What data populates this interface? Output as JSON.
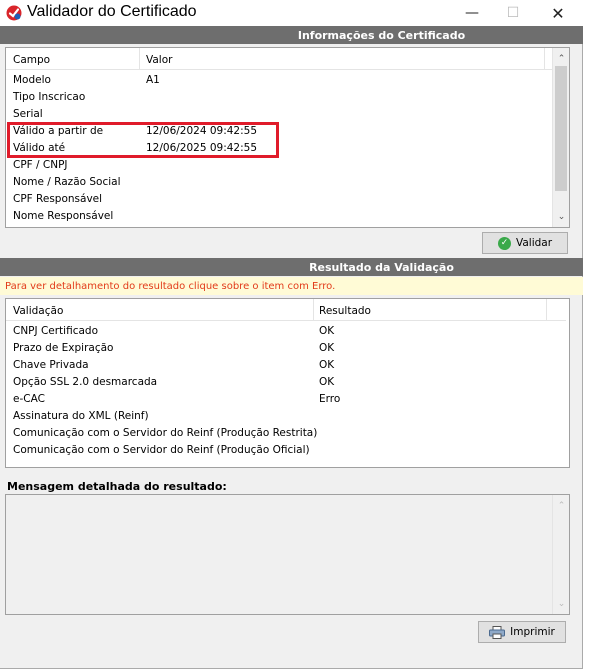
{
  "window": {
    "title": "Validador do Certificado",
    "controls": {
      "minimize": "—",
      "maximize": "☐",
      "close": "✕"
    }
  },
  "cert_section": {
    "header": "Informações do Certificado",
    "columns": [
      "Campo",
      "Valor"
    ],
    "rows": [
      {
        "campo": "Modelo",
        "valor": "A1"
      },
      {
        "campo": "Tipo Inscricao",
        "valor": ""
      },
      {
        "campo": "Serial",
        "valor": ""
      },
      {
        "campo": "Válido a partir de",
        "valor": "12/06/2024 09:42:55"
      },
      {
        "campo": "Válido até",
        "valor": "12/06/2025 09:42:55"
      },
      {
        "campo": "CPF / CNPJ",
        "valor": ""
      },
      {
        "campo": "Nome / Razão Social",
        "valor": ""
      },
      {
        "campo": "CPF Responsável",
        "valor": ""
      },
      {
        "campo": "Nome Responsável",
        "valor": ""
      }
    ],
    "validate_button": "Validar",
    "highlight_color": "#e01b2a"
  },
  "result_section": {
    "header": "Resultado da Validação",
    "info_text": "Para ver detalhamento do resultado clique sobre o item com Erro.",
    "columns": [
      "Validação",
      "Resultado"
    ],
    "rows": [
      {
        "validacao": "CNPJ Certificado",
        "resultado": "OK"
      },
      {
        "validacao": "Prazo de Expiração",
        "resultado": "OK"
      },
      {
        "validacao": "Chave Privada",
        "resultado": "OK"
      },
      {
        "validacao": "Opção SSL 2.0 desmarcada",
        "resultado": "OK"
      },
      {
        "validacao": "e-CAC",
        "resultado": "Erro"
      },
      {
        "validacao": "Assinatura do XML (Reinf)",
        "resultado": ""
      },
      {
        "validacao": "Comunicação com o Servidor do Reinf (Produção Restrita)",
        "resultado": ""
      },
      {
        "validacao": "Comunicação com o Servidor do Reinf (Produção Oficial)",
        "resultado": ""
      }
    ],
    "message_label": "Mensagem detalhada do resultado:",
    "message_text": "",
    "print_button": "Imprimir"
  },
  "icons": {
    "app": "certificate-app-icon",
    "validate": "check-circle-icon",
    "print": "printer-icon"
  },
  "colors": {
    "header_bg": "#6e6e6e",
    "info_bg": "#fffbd6",
    "info_text": "#e23b1a",
    "check": "#3aa94a"
  }
}
